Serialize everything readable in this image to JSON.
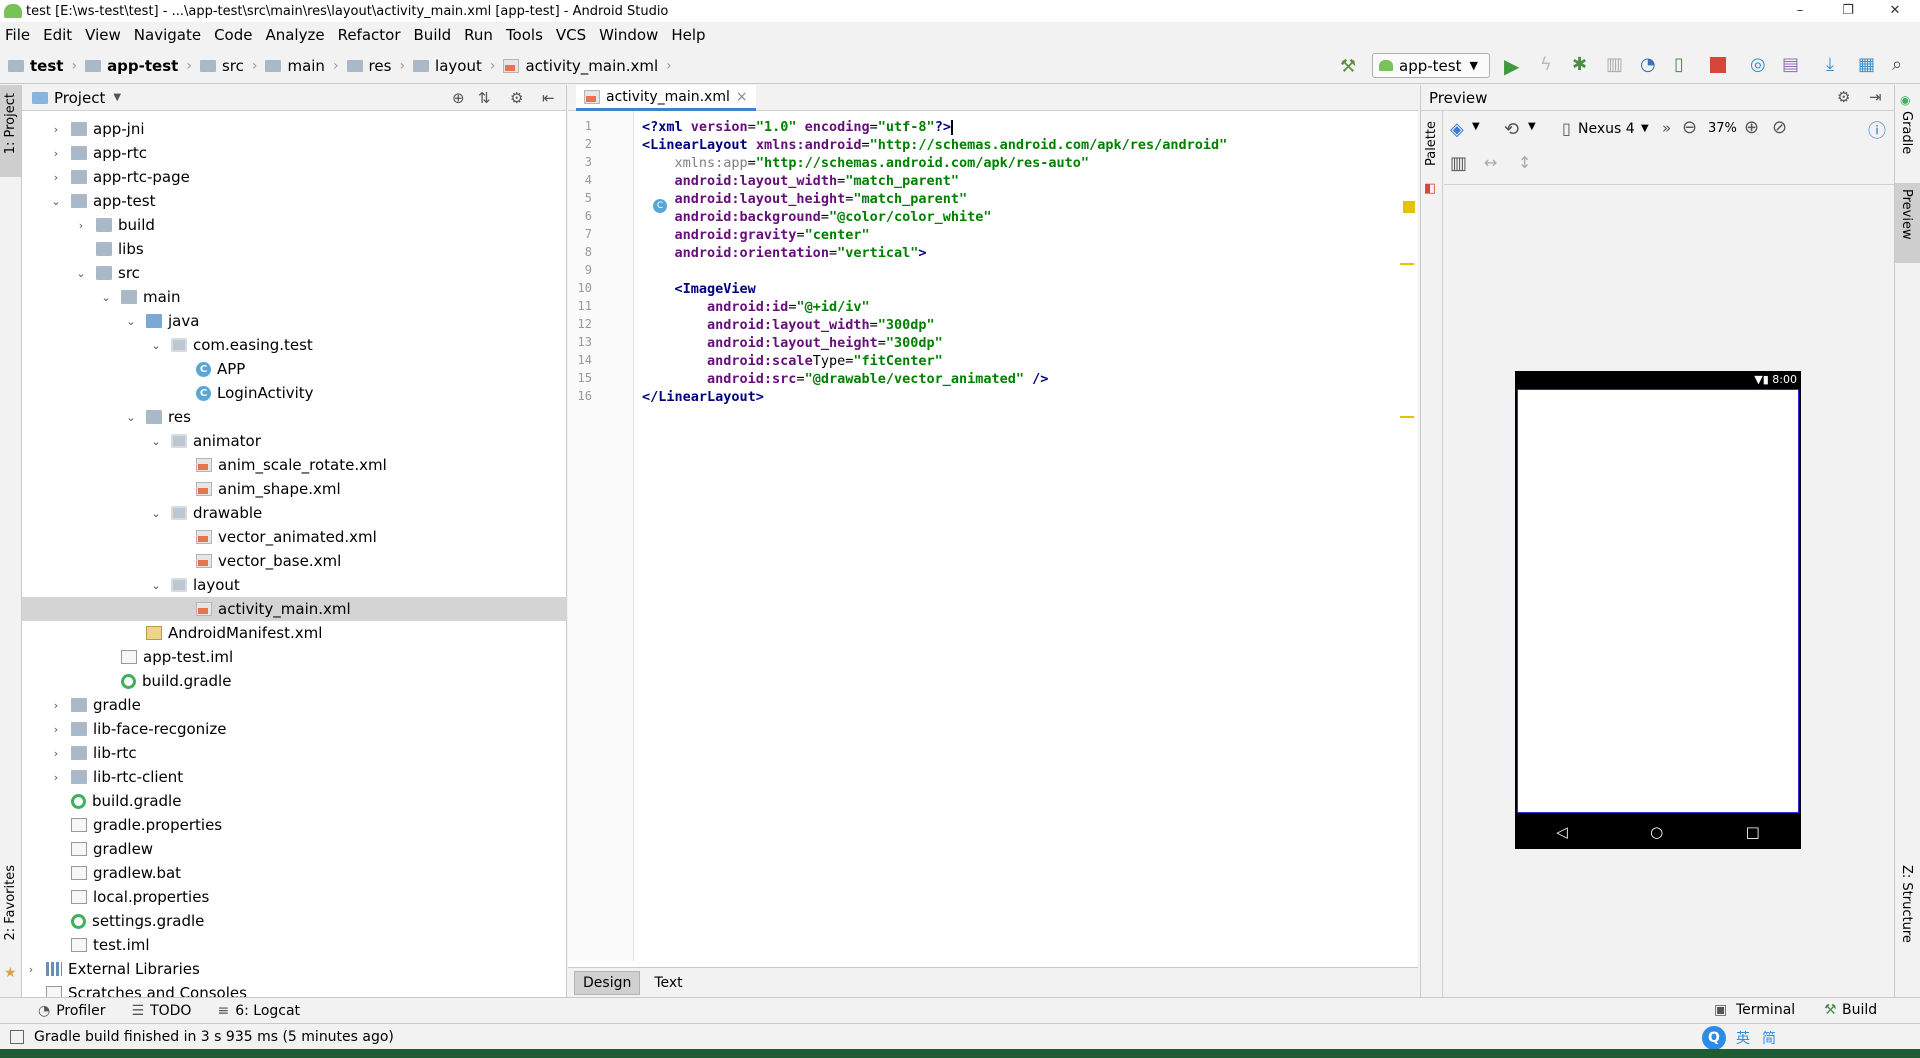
{
  "window": {
    "title": "test [E:\\ws-test\\test] - ...\\app-test\\src\\main\\res\\layout\\activity_main.xml [app-test] - Android Studio",
    "minimize": "–",
    "maximize": "❐",
    "close": "✕"
  },
  "menu": [
    "File",
    "Edit",
    "View",
    "Navigate",
    "Code",
    "Analyze",
    "Refactor",
    "Build",
    "Run",
    "Tools",
    "VCS",
    "Window",
    "Help"
  ],
  "breadcrumbs": [
    "test",
    "app-test",
    "src",
    "main",
    "res",
    "layout",
    "activity_main.xml"
  ],
  "run_config": "app-test",
  "left_strip": {
    "project_tab": "1: Project",
    "favorites_tab": "2: Favorites"
  },
  "project_panel": {
    "title": "Project",
    "tree": [
      {
        "label": "app-jni",
        "arrow": "›"
      },
      {
        "label": "app-rtc",
        "arrow": "›"
      },
      {
        "label": "app-rtc-page",
        "arrow": "›"
      },
      {
        "label": "app-test",
        "arrow": "⌄"
      },
      {
        "label": "build",
        "arrow": "›"
      },
      {
        "label": "libs",
        "arrow": ""
      },
      {
        "label": "src",
        "arrow": "⌄"
      },
      {
        "label": "main",
        "arrow": "⌄"
      },
      {
        "label": "java",
        "arrow": "⌄"
      },
      {
        "label": "com.easing.test",
        "arrow": "⌄"
      },
      {
        "label": "APP",
        "arrow": ""
      },
      {
        "label": "LoginActivity",
        "arrow": ""
      },
      {
        "label": "res",
        "arrow": "⌄"
      },
      {
        "label": "animator",
        "arrow": "⌄"
      },
      {
        "label": "anim_scale_rotate.xml",
        "arrow": ""
      },
      {
        "label": "anim_shape.xml",
        "arrow": ""
      },
      {
        "label": "drawable",
        "arrow": "⌄"
      },
      {
        "label": "vector_animated.xml",
        "arrow": ""
      },
      {
        "label": "vector_base.xml",
        "arrow": ""
      },
      {
        "label": "layout",
        "arrow": "⌄"
      },
      {
        "label": "activity_main.xml",
        "arrow": ""
      },
      {
        "label": "AndroidManifest.xml",
        "arrow": ""
      },
      {
        "label": "app-test.iml",
        "arrow": ""
      },
      {
        "label": "build.gradle",
        "arrow": ""
      },
      {
        "label": "gradle",
        "arrow": "›"
      },
      {
        "label": "lib-face-recgonize",
        "arrow": "›"
      },
      {
        "label": "lib-rtc",
        "arrow": "›"
      },
      {
        "label": "lib-rtc-client",
        "arrow": "›"
      },
      {
        "label": "build.gradle",
        "arrow": ""
      },
      {
        "label": "gradle.properties",
        "arrow": ""
      },
      {
        "label": "gradlew",
        "arrow": ""
      },
      {
        "label": "gradlew.bat",
        "arrow": ""
      },
      {
        "label": "local.properties",
        "arrow": ""
      },
      {
        "label": "settings.gradle",
        "arrow": ""
      },
      {
        "label": "test.iml",
        "arrow": ""
      },
      {
        "label": "External Libraries",
        "arrow": "›"
      },
      {
        "label": "Scratches and Consoles",
        "arrow": ""
      }
    ]
  },
  "editor": {
    "tab_label": "activity_main.xml",
    "tab_close": "×",
    "line_numbers": [
      "1",
      "2",
      "3",
      "4",
      "5",
      "6",
      "7",
      "8",
      "9",
      "10",
      "11",
      "12",
      "13",
      "14",
      "15",
      "16"
    ],
    "lines": [
      "<?xml version=\"1.0\" encoding=\"utf-8\"?>",
      "<LinearLayout xmlns:android=\"http://schemas.android.com/apk/res/android\"",
      "    xmlns:app=\"http://schemas.android.com/apk/res-auto\"",
      "    android:layout_width=\"match_parent\"",
      "    android:layout_height=\"match_parent\"",
      "    android:background=\"@color/color_white\"",
      "    android:gravity=\"center\"",
      "    android:orientation=\"vertical\">",
      "",
      "    <ImageView",
      "        android:id=\"@+id/iv\"",
      "        android:layout_width=\"300dp\"",
      "        android:layout_height=\"300dp\"",
      "        android:scaleType=\"fitCenter\"",
      "        android:src=\"@drawable/vector_animated\" />",
      "</LinearLayout>"
    ],
    "bottom_tabs": [
      "Design",
      "Text"
    ]
  },
  "preview": {
    "title": "Preview",
    "palette_label": "Palette",
    "device": "Nexus 4",
    "zoom": "37%",
    "status_time": "8:00"
  },
  "right_strip": {
    "gradle_tab": "Gradle",
    "preview_tab": "Preview",
    "structure_tab": "Z: Structure"
  },
  "bottom_tools": [
    "Profiler",
    "TODO",
    "6: Logcat"
  ],
  "bottom_tools_right": [
    "Terminal",
    "Build"
  ],
  "status": "Gradle build finished in 3 s 935 ms (5 minutes ago)",
  "ime": [
    "英",
    "简"
  ],
  "colors": {
    "accent": "#4083c9",
    "tag": "#000080",
    "attr_value": "#008000",
    "attr_ns": "#660e7a",
    "selection": "#d4d4d4"
  }
}
